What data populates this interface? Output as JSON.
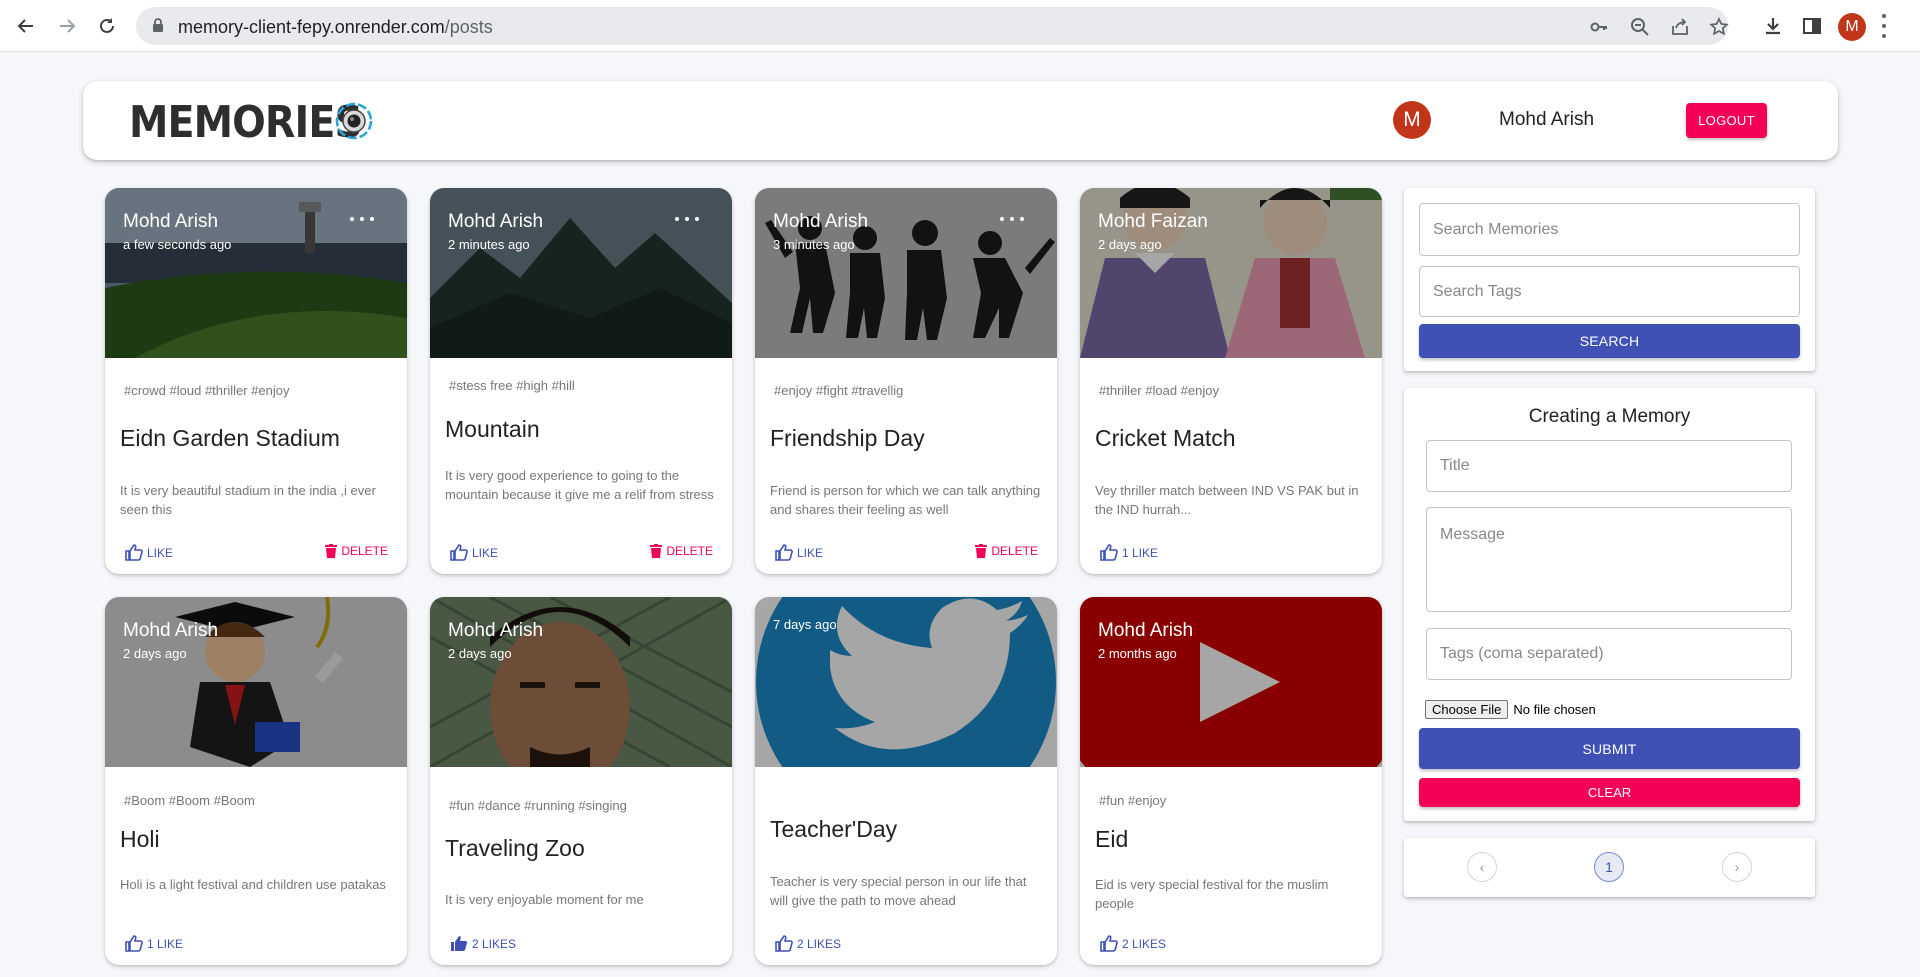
{
  "browser": {
    "url_host": "memory-client-fepy.onrender.com",
    "url_path": "/posts",
    "profile_initial": "M"
  },
  "header": {
    "brand": "MEMORIES",
    "avatar_initial": "M",
    "user_name": "Mohd Arish",
    "logout_label": "LOGOUT"
  },
  "posts": [
    {
      "author": "Mohd Arish",
      "time": "a few seconds ago",
      "tags": "#crowd #loud #thriller #enjoy",
      "title": "Eidn Garden Stadium",
      "message": "It is very beautiful stadium in the india ,i ever seen this",
      "like": "LIKE",
      "delete": "DELETE"
    },
    {
      "author": "Mohd Arish",
      "time": "2 minutes ago",
      "tags": "#stess free #high #hill",
      "title": "Mountain",
      "message": "It is very good experience to going to the mountain because it give me a relif from stress",
      "like": "LIKE",
      "delete": "DELETE"
    },
    {
      "author": "Mohd Arish",
      "time": "3 minutes ago",
      "tags": "#enjoy #fight #travellig",
      "title": "Friendship Day",
      "message": "Friend is person for which we can talk anything and shares their feeling as well",
      "like": "LIKE",
      "delete": "DELETE"
    },
    {
      "author": "Mohd Faizan",
      "time": "2 days ago",
      "tags": "#thriller #load #enjoy",
      "title": "Cricket Match",
      "message": "Vey thriller match between IND VS PAK but in the IND hurrah...",
      "like": "1 LIKE"
    },
    {
      "author": "Mohd Arish",
      "time": "2 days ago",
      "tags": "#Boom #Boom #Boom",
      "title": "Holi",
      "message": "Holi is a light festival and children use patakas",
      "like": "1 LIKE"
    },
    {
      "author": "Mohd Arish",
      "time": "2 days ago",
      "tags": "#fun #dance #running #singing",
      "title": "Traveling Zoo",
      "message": "It is very enjoyable moment for me",
      "like": "2 LIKES"
    },
    {
      "author": "",
      "time": "7 days ago",
      "tags": "",
      "title": "Teacher'Day",
      "message": "Teacher is very special person in our life that will give the path to move ahead",
      "like": "2 LIKES"
    },
    {
      "author": "Mohd Arish",
      "time": "2 months ago",
      "tags": "#fun #enjoy",
      "title": "Eid",
      "message": "Eid is very special festival for the muslim people",
      "like": "2 LIKES"
    }
  ],
  "search": {
    "memories_placeholder": "Search Memories",
    "tags_placeholder": "Search Tags",
    "button": "SEARCH"
  },
  "form": {
    "heading": "Creating a Memory",
    "title_placeholder": "Title",
    "message_placeholder": "Message",
    "tags_placeholder": "Tags (coma separated)",
    "file_button": "Choose File",
    "file_status": "No file chosen",
    "submit": "SUBMIT",
    "clear": "CLEAR"
  },
  "pagination": {
    "prev": "‹",
    "current": "1",
    "next": "›"
  },
  "colors": {
    "primary": "#3f51b5",
    "secondary": "#f50057",
    "avatar": "#c1351a"
  }
}
